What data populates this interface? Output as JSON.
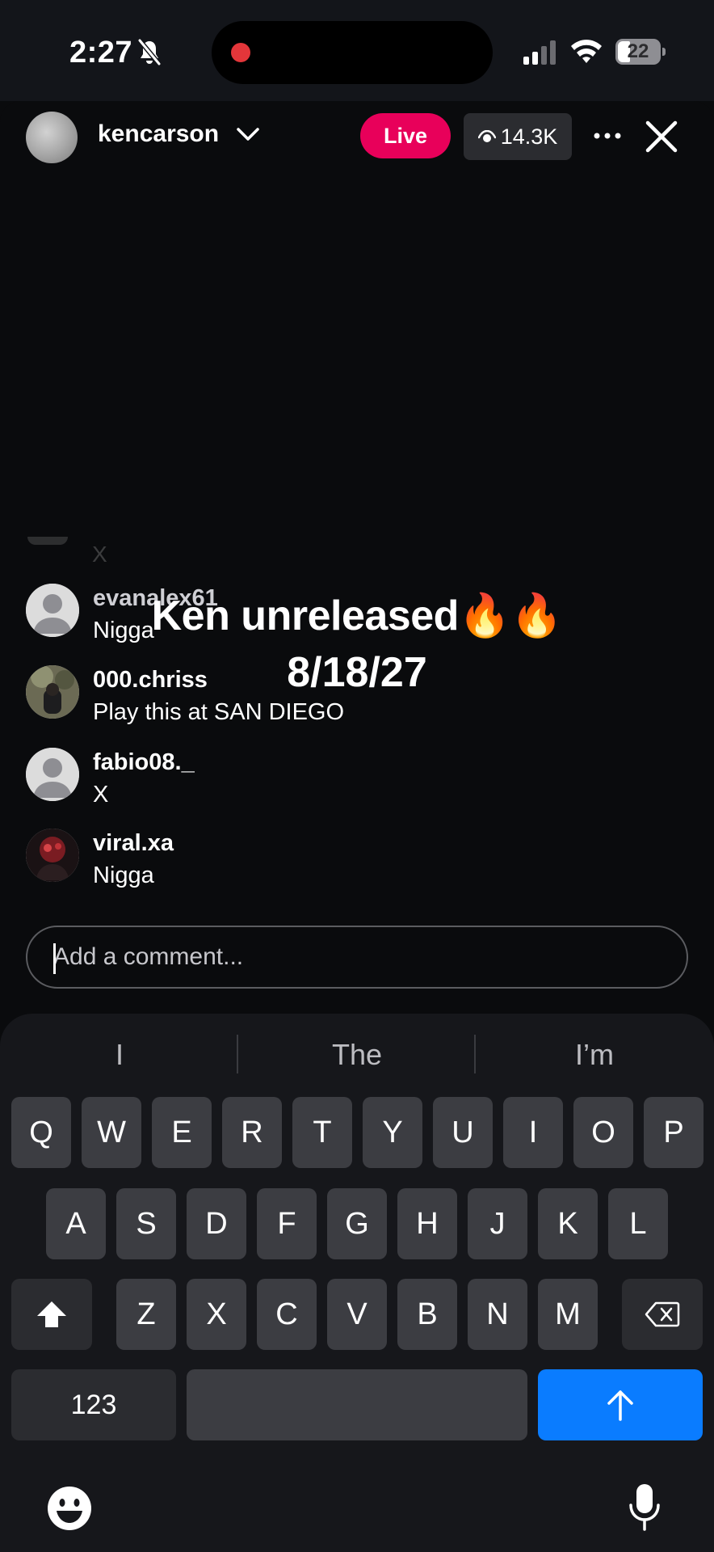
{
  "status_bar": {
    "time": "2:27",
    "battery": "22",
    "icons": [
      "bell-slash-icon",
      "recording-dot-icon",
      "cellular-signal-icon",
      "wifi-icon",
      "battery-icon"
    ]
  },
  "live": {
    "host_name": "kencarson",
    "live_label": "Live",
    "viewer_count": "14.3K",
    "faded_comment": "X",
    "overlay_title": "Ken unreleased🔥🔥",
    "overlay_date": "8/18/27",
    "comments": [
      {
        "user": "evanalex61",
        "text": "Nigga"
      },
      {
        "user": "000.chriss",
        "text": "Play this at SAN DIEGO"
      },
      {
        "user": "fabio08._",
        "text": "X"
      },
      {
        "user": "viral.xa",
        "text": "Nigga"
      }
    ],
    "comment_placeholder": "Add a comment..."
  },
  "keyboard": {
    "suggestions": [
      "I",
      "The",
      "I’m"
    ],
    "row1": [
      "Q",
      "W",
      "E",
      "R",
      "T",
      "Y",
      "U",
      "I",
      "O",
      "P"
    ],
    "row2": [
      "A",
      "S",
      "D",
      "F",
      "G",
      "H",
      "J",
      "K",
      "L"
    ],
    "row3": [
      "Z",
      "X",
      "C",
      "V",
      "B",
      "N",
      "M"
    ],
    "numbers_label": "123"
  },
  "colors": {
    "live_badge": "#e8005a",
    "send_key": "#0a7cff",
    "recording_dot": "#e3363a"
  }
}
